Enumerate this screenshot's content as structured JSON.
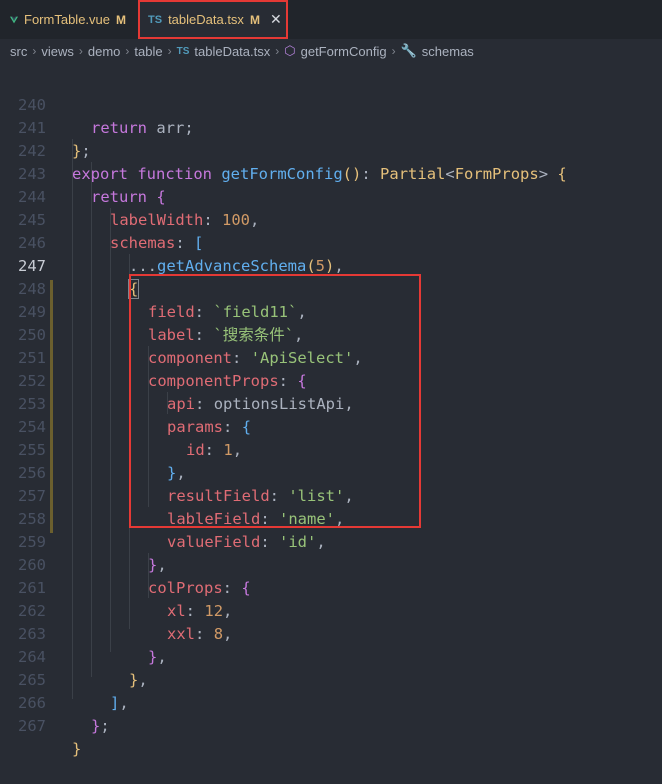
{
  "tabs": [
    {
      "name": "FormTable.vue",
      "modified": "M"
    },
    {
      "name": "tableData.tsx",
      "modified": "M",
      "icon": "TS"
    }
  ],
  "breadcrumb": [
    "src",
    "views",
    "demo",
    "table",
    "tableData.tsx",
    "getFormConfig",
    "schemas"
  ],
  "breadcrumb_icon_ts": "TS",
  "colors": {
    "keyword": "#c678dd",
    "function": "#61afef",
    "property": "#e06c75",
    "number": "#d19a66",
    "string": "#98c379",
    "type": "#e5c07b",
    "highlight": "#e53935"
  },
  "editor": {
    "current_line": "247",
    "lines": [
      {
        "n": "240",
        "code": "return arr;"
      },
      {
        "n": "241",
        "code": "};"
      },
      {
        "n": "242",
        "code": "export function getFormConfig(): Partial<FormProps> {"
      },
      {
        "n": "243",
        "code": "return {"
      },
      {
        "n": "244",
        "code": "labelWidth: 100,"
      },
      {
        "n": "245",
        "code": "schemas: ["
      },
      {
        "n": "246",
        "code": "...getAdvanceSchema(5),"
      },
      {
        "n": "247",
        "code": "{"
      },
      {
        "n": "248",
        "code": "field: `field11`,"
      },
      {
        "n": "249",
        "code": "label: `搜索条件`,"
      },
      {
        "n": "250",
        "code": "component: 'ApiSelect',"
      },
      {
        "n": "251",
        "code": "componentProps: {"
      },
      {
        "n": "252",
        "code": "api: optionsListApi,"
      },
      {
        "n": "253",
        "code": "params: {"
      },
      {
        "n": "254",
        "code": "id: 1,"
      },
      {
        "n": "255",
        "code": "},"
      },
      {
        "n": "256",
        "code": "resultField: 'list',"
      },
      {
        "n": "257",
        "code": "lableField: 'name',"
      },
      {
        "n": "258",
        "code": "valueField: 'id',"
      },
      {
        "n": "259",
        "code": "},"
      },
      {
        "n": "260",
        "code": "colProps: {"
      },
      {
        "n": "261",
        "code": "xl: 12,"
      },
      {
        "n": "262",
        "code": "xxl: 8,"
      },
      {
        "n": "263",
        "code": "},"
      },
      {
        "n": "264",
        "code": "},"
      },
      {
        "n": "265",
        "code": "],"
      },
      {
        "n": "266",
        "code": "};"
      },
      {
        "n": "267",
        "code": "}"
      }
    ]
  }
}
